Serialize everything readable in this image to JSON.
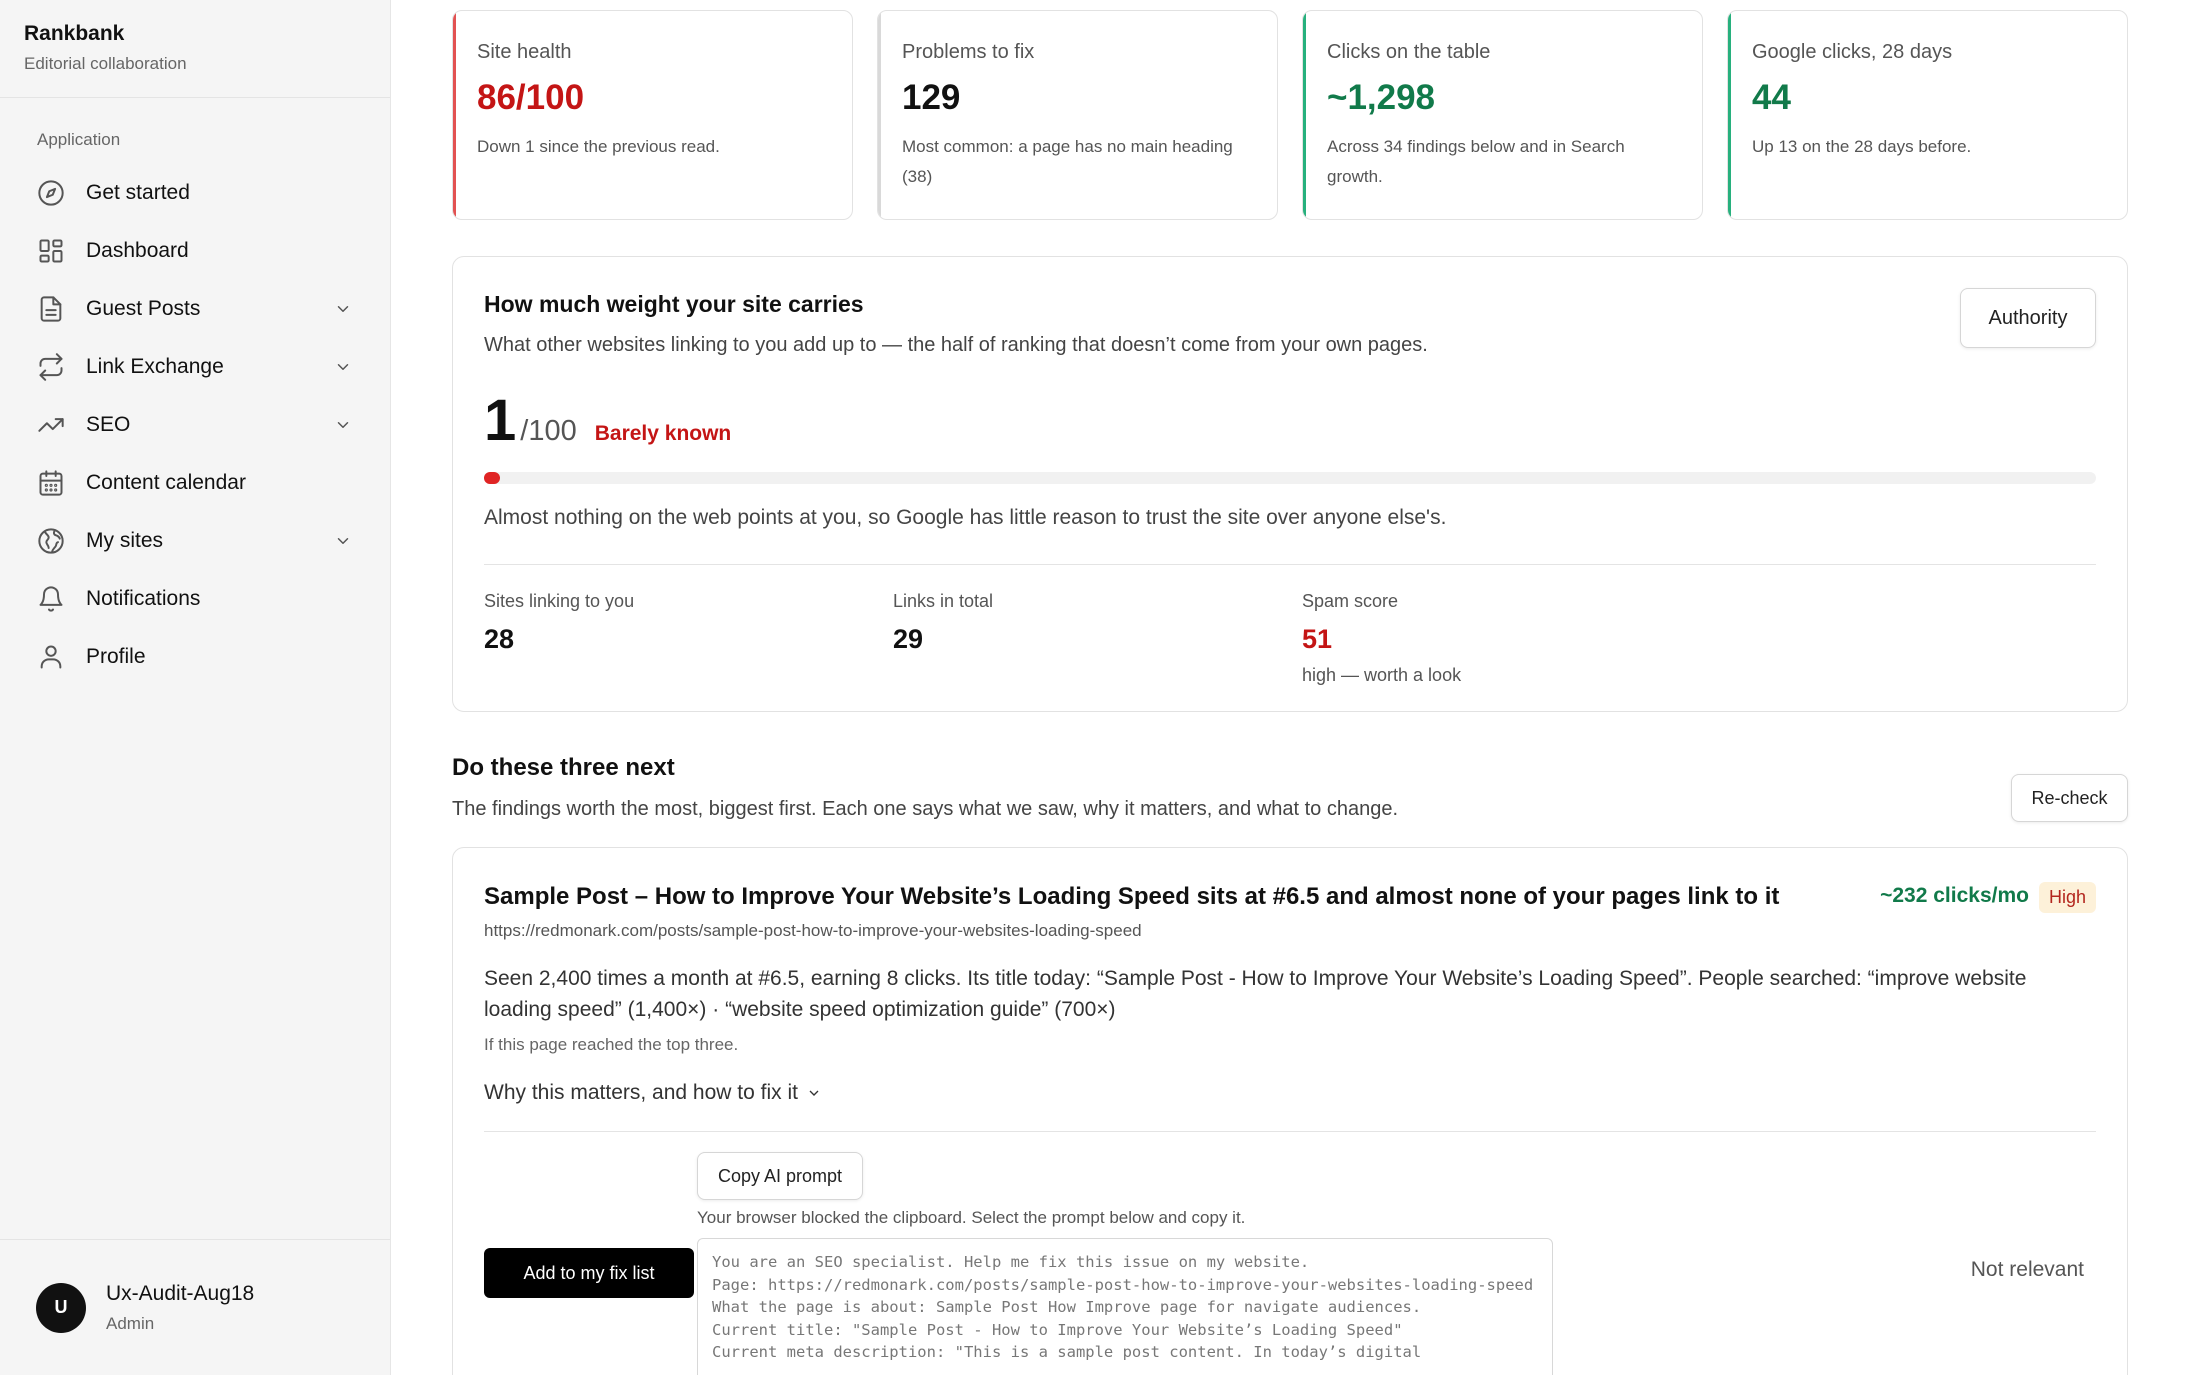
{
  "brand": {
    "title": "Rankbank",
    "subtitle": "Editorial collaboration"
  },
  "nav": {
    "section_label": "Application",
    "items": [
      {
        "label": "Get started",
        "icon": "compass-icon"
      },
      {
        "label": "Dashboard",
        "icon": "dashboard-icon"
      },
      {
        "label": "Guest Posts",
        "icon": "document-icon",
        "expandable": true
      },
      {
        "label": "Link Exchange",
        "icon": "exchange-icon",
        "expandable": true
      },
      {
        "label": "SEO",
        "icon": "trending-up-icon",
        "expandable": true
      },
      {
        "label": "Content calendar",
        "icon": "calendar-icon"
      },
      {
        "label": "My sites",
        "icon": "globe-icon",
        "expandable": true
      },
      {
        "label": "Notifications",
        "icon": "bell-icon"
      },
      {
        "label": "Profile",
        "icon": "user-icon"
      }
    ]
  },
  "user": {
    "initial": "U",
    "name": "Ux-Audit-Aug18",
    "role": "Admin"
  },
  "stats": [
    {
      "label": "Site health",
      "value": "86/100",
      "desc": "Down 1 since the previous read.",
      "tone": "red"
    },
    {
      "label": "Problems to fix",
      "value": "129",
      "desc": "Most common: a page has no main heading (38)",
      "tone": "gray"
    },
    {
      "label": "Clicks on the table",
      "value": "~1,298",
      "desc": "Across 34 findings below and in Search growth.",
      "tone": "green"
    },
    {
      "label": "Google clicks, 28 days",
      "value": "44",
      "desc": "Up 13 on the 28 days before.",
      "tone": "green"
    }
  ],
  "authority": {
    "title": "How much weight your site carries",
    "subtitle": "What other websites linking to you add up to — the half of ranking that doesn’t come from your own pages.",
    "button_label": "Authority",
    "score": "1",
    "score_max": "/100",
    "score_value": 1,
    "score_tag": "Barely known",
    "note": "Almost nothing on the web points at you, so Google has little reason to trust the site over anyone else's.",
    "metrics": [
      {
        "label": "Sites linking to you",
        "value": "28",
        "note": ""
      },
      {
        "label": "Links in total",
        "value": "29",
        "note": ""
      },
      {
        "label": "Spam score",
        "value": "51",
        "note": "high — worth a look"
      }
    ]
  },
  "next": {
    "title": "Do these three next",
    "subtitle": "The findings worth the most, biggest first. Each one says what we saw, why it matters, and what to change.",
    "recheck_label": "Re-check"
  },
  "finding": {
    "title": "Sample Post – How to Improve Your Website’s Loading Speed sits at #6.5 and almost none of your pages link to it",
    "clicks": "~232 clicks/mo",
    "badge": "High",
    "url": "https://redmonark.com/posts/sample-post-how-to-improve-your-websites-loading-speed",
    "body": "Seen 2,400 times a month at #6.5, earning 8 clicks. Its title today: “Sample Post - How to Improve Your Website’s Loading Speed”. People searched: “improve website loading speed” (1,400×) · “website speed optimization guide” (700×)",
    "if_note": "If this page reached the top three.",
    "why_label": "Why this matters, and how to fix it",
    "copy_label": "Copy AI prompt",
    "blocked_note": "Your browser blocked the clipboard. Select the prompt below and copy it.",
    "add_label": "Add to my fix list",
    "not_relevant_label": "Not relevant",
    "prompt_text": "You are an SEO specialist. Help me fix this issue on my website.\nPage: https://redmonark.com/posts/sample-post-how-to-improve-your-websites-loading-speed\nWhat the page is about: Sample Post How Improve page for navigate audiences.\nCurrent title: \"Sample Post - How to Improve Your Website’s Loading Speed\"\nCurrent meta description: \"This is a sample post content. In today’s digital"
  }
}
